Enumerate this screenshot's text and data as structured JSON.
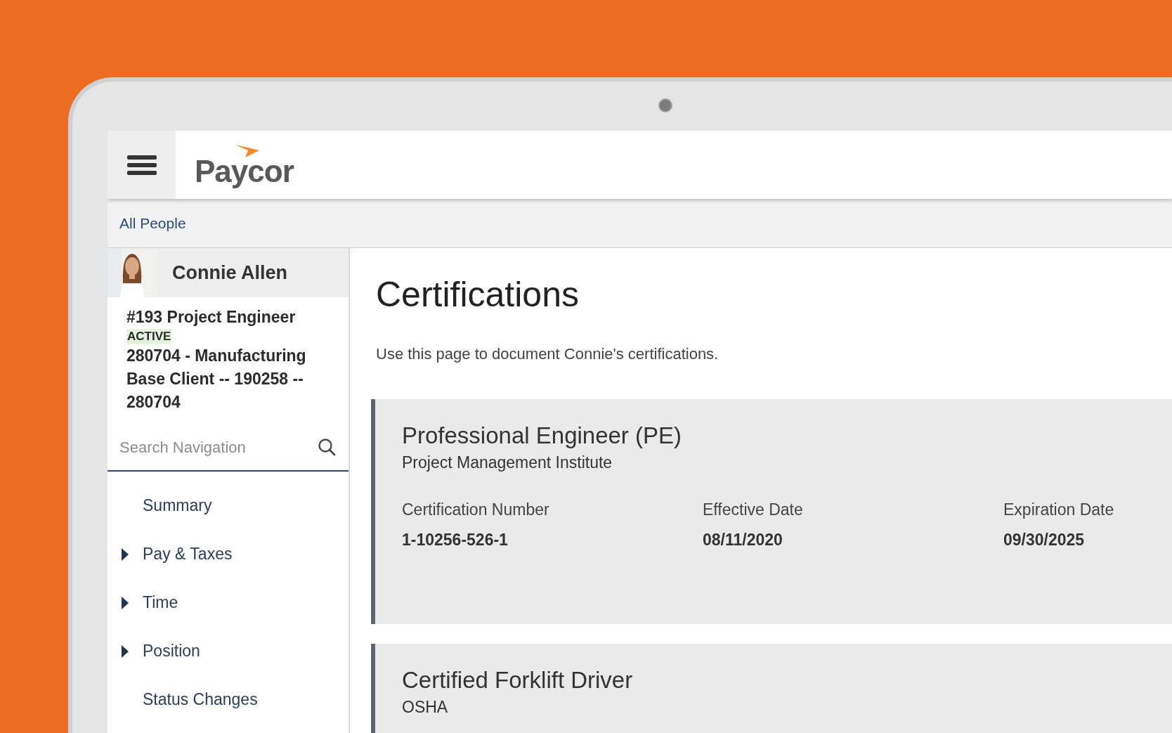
{
  "app": {
    "logo": "Paycor"
  },
  "breadcrumb": "All People",
  "profile": {
    "name": "Connie Allen",
    "position": "#193 Project Engineer",
    "status": "ACTIVE",
    "client": "280704 - Manufacturing Base Client -- 190258 -- 280704"
  },
  "search": {
    "placeholder": "Search Navigation"
  },
  "nav": [
    {
      "label": "Summary",
      "expandable": false
    },
    {
      "label": "Pay & Taxes",
      "expandable": true
    },
    {
      "label": "Time",
      "expandable": true
    },
    {
      "label": "Position",
      "expandable": true
    },
    {
      "label": "Status Changes",
      "expandable": false
    }
  ],
  "page": {
    "title": "Certifications",
    "description": "Use this page to document Connie's certifications."
  },
  "certifications": [
    {
      "title": "Professional Engineer (PE)",
      "issuer": "Project Management Institute",
      "fields": [
        {
          "label": "Certification Number",
          "value": "1-10256-526-1"
        },
        {
          "label": "Effective Date",
          "value": "08/11/2020"
        },
        {
          "label": "Expiration Date",
          "value": "09/30/2025"
        }
      ]
    },
    {
      "title": "Certified Forklift Driver",
      "issuer": "OSHA"
    }
  ]
}
